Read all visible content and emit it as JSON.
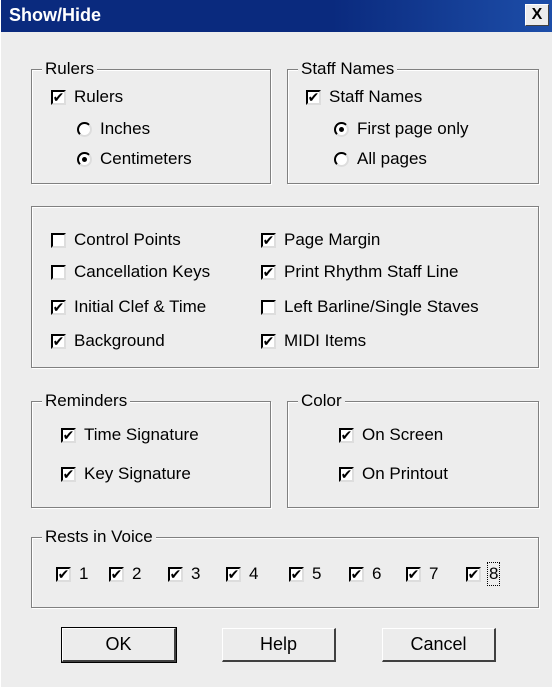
{
  "window": {
    "title": "Show/Hide",
    "close_glyph": "X"
  },
  "rulers": {
    "legend": "Rulers",
    "rulers_cb": {
      "label": "Rulers",
      "checked": true
    },
    "inches": {
      "label": "Inches",
      "selected": false
    },
    "centimeters": {
      "label": "Centimeters",
      "selected": true
    }
  },
  "staff_names": {
    "legend": "Staff Names",
    "staff_names_cb": {
      "label": "Staff Names",
      "checked": true
    },
    "first_page": {
      "label": "First page only",
      "selected": true
    },
    "all_pages": {
      "label": "All pages",
      "selected": false
    }
  },
  "display": {
    "control_points": {
      "label": "Control Points",
      "checked": false
    },
    "cancellation_keys": {
      "label": "Cancellation Keys",
      "checked": false
    },
    "initial_clef": {
      "label": "Initial Clef & Time",
      "checked": true
    },
    "background": {
      "label": "Background",
      "checked": true
    },
    "page_margin": {
      "label": "Page Margin",
      "checked": true
    },
    "print_rhythm": {
      "label": "Print Rhythm Staff Line",
      "checked": true
    },
    "left_barline": {
      "label": "Left Barline/Single Staves",
      "checked": false
    },
    "midi_items": {
      "label": "MIDI Items",
      "checked": true
    }
  },
  "reminders": {
    "legend": "Reminders",
    "time_sig": {
      "label": "Time Signature",
      "checked": true
    },
    "key_sig": {
      "label": "Key Signature",
      "checked": true
    }
  },
  "color": {
    "legend": "Color",
    "on_screen": {
      "label": "On Screen",
      "checked": true
    },
    "on_printout": {
      "label": "On Printout",
      "checked": true
    }
  },
  "rests": {
    "legend": "Rests in Voice",
    "voices": [
      {
        "label": "1",
        "checked": true
      },
      {
        "label": "2",
        "checked": true
      },
      {
        "label": "3",
        "checked": true
      },
      {
        "label": "4",
        "checked": true
      },
      {
        "label": "5",
        "checked": true
      },
      {
        "label": "6",
        "checked": true
      },
      {
        "label": "7",
        "checked": true
      },
      {
        "label": "8",
        "checked": true
      }
    ]
  },
  "buttons": {
    "ok": "OK",
    "help": "Help",
    "cancel": "Cancel"
  }
}
